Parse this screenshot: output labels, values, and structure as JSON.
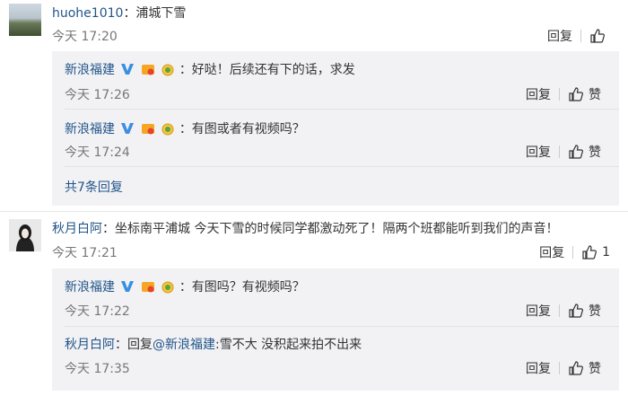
{
  "comments": [
    {
      "author": "huohe1010",
      "text": "：浦城下雪",
      "time": "今天 17:20",
      "reply_label": "回复",
      "like_label": "",
      "replies": [
        {
          "author": "新浪福建",
          "text": "：好哒！后续还有下的话，求发",
          "time": "今天 17:26",
          "reply_label": "回复",
          "like_label": "赞"
        },
        {
          "author": "新浪福建",
          "text": "：有图或者有视频吗？",
          "time": "今天 17:24",
          "reply_label": "回复",
          "like_label": "赞"
        }
      ],
      "more_replies": "共7条回复"
    },
    {
      "author": "秋月白阿",
      "text": "：坐标南平浦城 今天下雪的时候同学都激动死了！隔两个班都能听到我们的声音！",
      "time": "今天 17:21",
      "reply_label": "回复",
      "like_label": "1",
      "replies": [
        {
          "author": "新浪福建",
          "text": "：有图吗？有视频吗？",
          "time": "今天 17:22",
          "reply_label": "回复",
          "like_label": "赞"
        },
        {
          "author": "秋月白阿",
          "text": "：回复",
          "mention": "@新浪福建",
          "text2": ":雪不大 没积起来拍不出来",
          "time": "今天 17:35",
          "reply_label": "回复",
          "like_label": "赞"
        }
      ]
    }
  ],
  "colors": {
    "author": "#225588",
    "reply_bg": "#f2f2f5",
    "vip_v": "#3b8fe0"
  }
}
